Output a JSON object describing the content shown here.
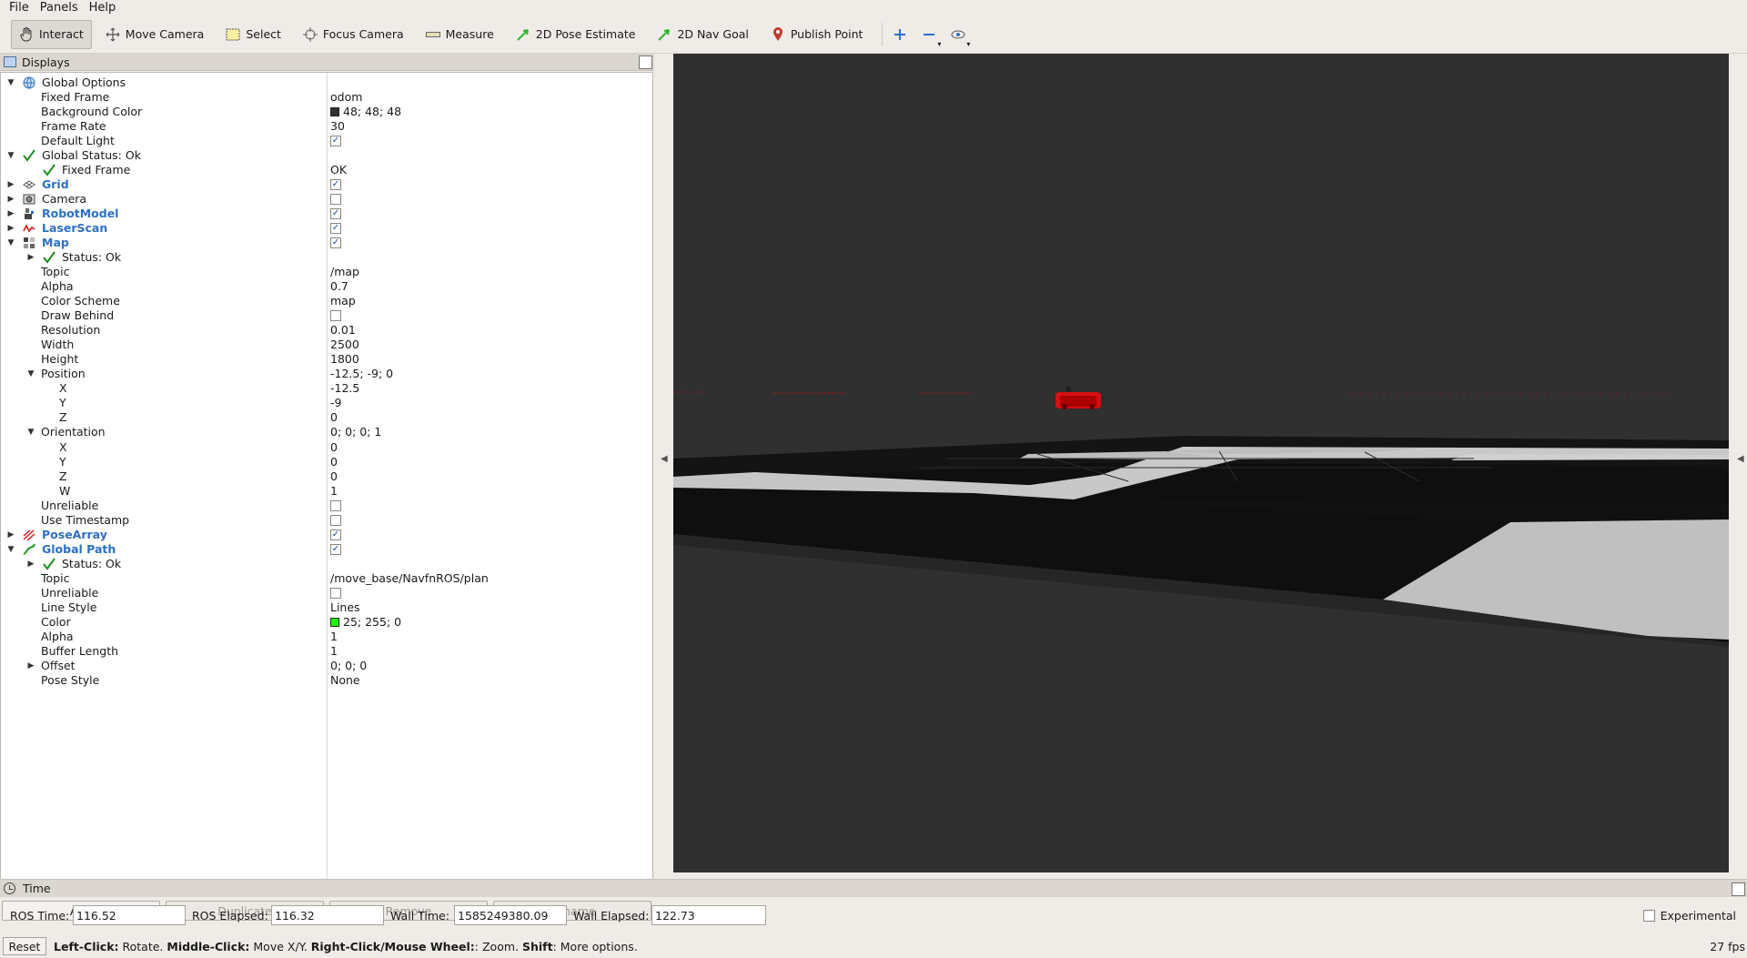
{
  "menus": [
    "File",
    "Panels",
    "Help"
  ],
  "toolbar": {
    "interact": "Interact",
    "move_camera": "Move Camera",
    "select": "Select",
    "focus_camera": "Focus Camera",
    "measure": "Measure",
    "pose_estimate": "2D Pose Estimate",
    "nav_goal": "2D Nav Goal",
    "publish_point": "Publish Point"
  },
  "displays": {
    "title": "Displays",
    "tree": [
      {
        "label": "Global Options",
        "value": "",
        "depth": 0,
        "arrow": "down",
        "icon": "globe-icon"
      },
      {
        "label": "Fixed Frame",
        "value": "odom",
        "depth": 1
      },
      {
        "label": "Background Color",
        "value": "48; 48; 48",
        "depth": 1,
        "swatch": "#303030"
      },
      {
        "label": "Frame Rate",
        "value": "30",
        "depth": 1
      },
      {
        "label": "Default Light",
        "value": "",
        "depth": 1,
        "check": true
      },
      {
        "label": "Global Status: Ok",
        "value": "",
        "depth": 0,
        "arrow": "down",
        "icon": "check-icon"
      },
      {
        "label": "Fixed Frame",
        "value": "OK",
        "depth": 1,
        "icon": "check-icon"
      },
      {
        "label": "Grid",
        "value": "",
        "depth": 0,
        "arrow": "right",
        "icon": "grid-icon",
        "plugin": true,
        "check": true
      },
      {
        "label": "Camera",
        "value": "",
        "depth": 0,
        "arrow": "right",
        "icon": "camera-icon",
        "check": false
      },
      {
        "label": "RobotModel",
        "value": "",
        "depth": 0,
        "arrow": "right",
        "icon": "robot-icon",
        "plugin": true,
        "check": true
      },
      {
        "label": "LaserScan",
        "value": "",
        "depth": 0,
        "arrow": "right",
        "icon": "laser-icon",
        "plugin": true,
        "check": true
      },
      {
        "label": "Map",
        "value": "",
        "depth": 0,
        "arrow": "down",
        "icon": "map-icon",
        "plugin": true,
        "check": true
      },
      {
        "label": "Status: Ok",
        "value": "",
        "depth": 1,
        "arrow": "right",
        "icon": "check-icon"
      },
      {
        "label": "Topic",
        "value": "/map",
        "depth": 1
      },
      {
        "label": "Alpha",
        "value": "0.7",
        "depth": 1
      },
      {
        "label": "Color Scheme",
        "value": "map",
        "depth": 1
      },
      {
        "label": "Draw Behind",
        "value": "",
        "depth": 1,
        "check": false
      },
      {
        "label": "Resolution",
        "value": "0.01",
        "depth": 1
      },
      {
        "label": "Width",
        "value": "2500",
        "depth": 1
      },
      {
        "label": "Height",
        "value": "1800",
        "depth": 1
      },
      {
        "label": "Position",
        "value": "-12.5; -9; 0",
        "depth": 1,
        "arrow": "down"
      },
      {
        "label": "X",
        "value": "-12.5",
        "depth": 2
      },
      {
        "label": "Y",
        "value": "-9",
        "depth": 2
      },
      {
        "label": "Z",
        "value": "0",
        "depth": 2
      },
      {
        "label": "Orientation",
        "value": "0; 0; 0; 1",
        "depth": 1,
        "arrow": "down"
      },
      {
        "label": "X",
        "value": "0",
        "depth": 2
      },
      {
        "label": "Y",
        "value": "0",
        "depth": 2
      },
      {
        "label": "Z",
        "value": "0",
        "depth": 2
      },
      {
        "label": "W",
        "value": "1",
        "depth": 2
      },
      {
        "label": "Unreliable",
        "value": "",
        "depth": 1,
        "check": false
      },
      {
        "label": "Use Timestamp",
        "value": "",
        "depth": 1,
        "check": false
      },
      {
        "label": "PoseArray",
        "value": "",
        "depth": 0,
        "arrow": "right",
        "icon": "posearray-icon",
        "plugin": true,
        "check": true
      },
      {
        "label": "Global Path",
        "value": "",
        "depth": 0,
        "arrow": "down",
        "icon": "path-icon",
        "plugin": true,
        "check": true
      },
      {
        "label": "Status: Ok",
        "value": "",
        "depth": 1,
        "arrow": "right",
        "icon": "check-icon"
      },
      {
        "label": "Topic",
        "value": "/move_base/NavfnROS/plan",
        "depth": 1
      },
      {
        "label": "Unreliable",
        "value": "",
        "depth": 1,
        "check": false
      },
      {
        "label": "Line Style",
        "value": "Lines",
        "depth": 1
      },
      {
        "label": "Color",
        "value": "25; 255; 0",
        "depth": 1,
        "swatch": "#19ff00"
      },
      {
        "label": "Alpha",
        "value": "1",
        "depth": 1
      },
      {
        "label": "Buffer Length",
        "value": "1",
        "depth": 1
      },
      {
        "label": "Offset",
        "value": "0; 0; 0",
        "depth": 1,
        "arrow": "right"
      },
      {
        "label": "Pose Style",
        "value": "None",
        "depth": 1
      }
    ],
    "buttons": {
      "add": "Add",
      "duplicate": "Duplicate",
      "remove": "Remove",
      "rename": "Rename"
    }
  },
  "time": {
    "title": "Time",
    "ros_time_label": "ROS Time:",
    "ros_time": "116.52",
    "ros_elapsed_label": "ROS Elapsed:",
    "ros_elapsed": "116.32",
    "wall_time_label": "Wall Time:",
    "wall_time": "1585249380.09",
    "wall_elapsed_label": "Wall Elapsed:",
    "wall_elapsed": "122.73",
    "experimental": "Experimental"
  },
  "status": {
    "reset": "Reset",
    "hint_left_click": "Left-Click:",
    "hint_left_text": " Rotate. ",
    "hint_middle_click": "Middle-Click:",
    "hint_middle_text": " Move X/Y. ",
    "hint_right_click": "Right-Click/Mouse Wheel:",
    "hint_right_text": ": Zoom. ",
    "hint_shift": "Shift",
    "hint_shift_text": ": More options.",
    "fps": "27 fps"
  },
  "colors": {
    "viewport_bg": "#303030",
    "plugin_label": "#2d6fc2",
    "robot": "#e01010"
  }
}
